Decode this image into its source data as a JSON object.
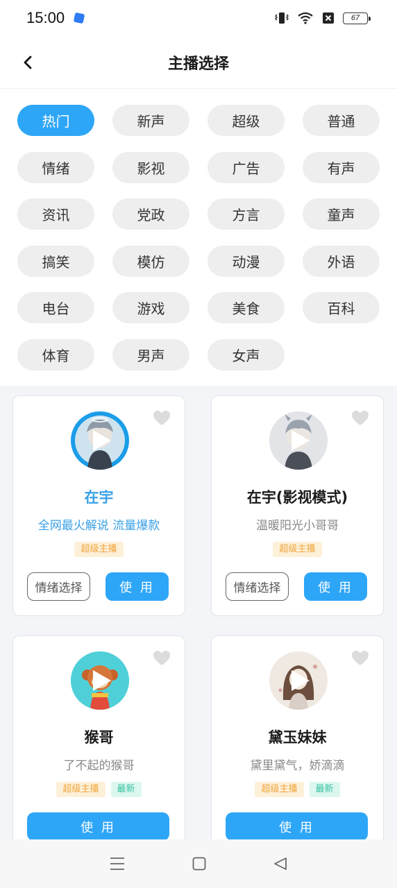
{
  "status_bar": {
    "time": "15:00",
    "battery": "67"
  },
  "header": {
    "title": "主播选择"
  },
  "categories": [
    {
      "label": "热门",
      "active": true
    },
    {
      "label": "新声"
    },
    {
      "label": "超级"
    },
    {
      "label": "普通"
    },
    {
      "label": "情绪"
    },
    {
      "label": "影视"
    },
    {
      "label": "广告"
    },
    {
      "label": "有声"
    },
    {
      "label": "资讯"
    },
    {
      "label": "党政"
    },
    {
      "label": "方言"
    },
    {
      "label": "童声"
    },
    {
      "label": "搞笑"
    },
    {
      "label": "模仿"
    },
    {
      "label": "动漫"
    },
    {
      "label": "外语"
    },
    {
      "label": "电台"
    },
    {
      "label": "游戏"
    },
    {
      "label": "美食"
    },
    {
      "label": "百科"
    },
    {
      "label": "体育"
    },
    {
      "label": "男声"
    },
    {
      "label": "女声"
    }
  ],
  "anchors": [
    {
      "name": "在宇",
      "desc": "全网最火解说 流量爆款",
      "tags": [
        "超级主播"
      ],
      "emotion_label": "情绪选择",
      "use_label": "使 用",
      "selected": true
    },
    {
      "name": "在宇(影视模式)",
      "desc": "温暖阳光小哥哥",
      "tags": [
        "超级主播"
      ],
      "emotion_label": "情绪选择",
      "use_label": "使 用"
    },
    {
      "name": "猴哥",
      "desc": "了不起的猴哥",
      "tags": [
        "超级主播",
        "最新"
      ],
      "use_label": "使 用"
    },
    {
      "name": "黛玉妹妹",
      "desc": "黛里黛气，娇滴滴",
      "tags": [
        "超级主播",
        "最新"
      ],
      "use_label": "使 用"
    }
  ],
  "colors": {
    "accent": "#2ea6f7",
    "selected_text": "#3aa0e6",
    "tag_super": "#f0a43a",
    "tag_new": "#36c2a0"
  },
  "icons": [
    "back-arrow-icon",
    "heart-icon",
    "play-icon",
    "menu-icon",
    "home-square-icon",
    "back-triangle-icon",
    "vibrate-icon",
    "wifi-icon",
    "no-sim-icon",
    "battery-icon"
  ]
}
